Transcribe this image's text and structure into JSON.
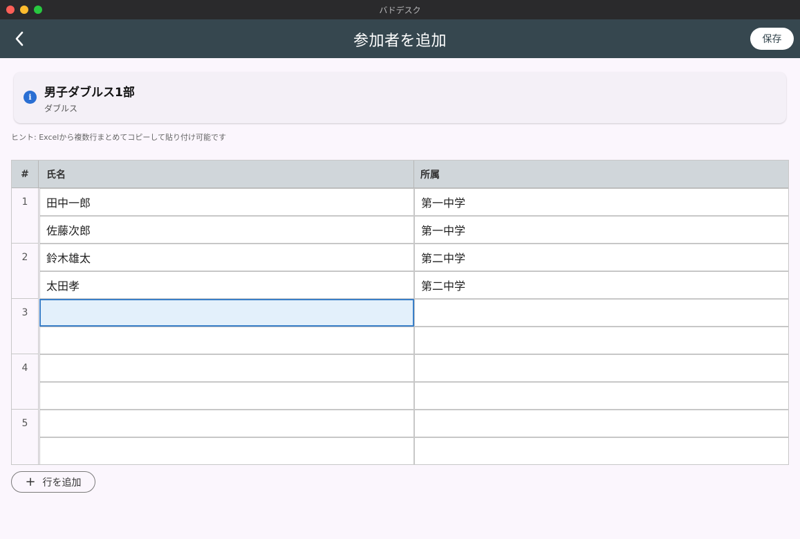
{
  "window": {
    "title": "バドデスク"
  },
  "appbar": {
    "title": "参加者を追加",
    "save_label": "保存",
    "back_icon": "chevron-left-icon"
  },
  "event": {
    "name": "男子ダブルス1部",
    "type": "ダブルス",
    "icon": "info-icon"
  },
  "hint": "ヒント: Excelから複数行まとめてコピーして貼り付け可能です",
  "table": {
    "headers": {
      "num": "#",
      "name": "氏名",
      "affiliation": "所属"
    },
    "rows": [
      {
        "num": "1",
        "players": [
          {
            "name": "田中一郎",
            "affiliation": "第一中学"
          },
          {
            "name": "佐藤次郎",
            "affiliation": "第一中学"
          }
        ]
      },
      {
        "num": "2",
        "players": [
          {
            "name": "鈴木雄太",
            "affiliation": "第二中学"
          },
          {
            "name": "太田孝",
            "affiliation": "第二中学"
          }
        ]
      },
      {
        "num": "3",
        "players": [
          {
            "name": "",
            "affiliation": ""
          },
          {
            "name": "",
            "affiliation": ""
          }
        ]
      },
      {
        "num": "4",
        "players": [
          {
            "name": "",
            "affiliation": ""
          },
          {
            "name": "",
            "affiliation": ""
          }
        ]
      },
      {
        "num": "5",
        "players": [
          {
            "name": "",
            "affiliation": ""
          },
          {
            "name": "",
            "affiliation": ""
          }
        ]
      }
    ],
    "selected_cell": {
      "row": 2,
      "player": 0,
      "column": "name"
    }
  },
  "add_row": {
    "label": "行を追加",
    "icon": "plus-icon"
  },
  "colors": {
    "appbar": "#36474f",
    "header_row": "#d0d6da",
    "info": "#2a6fd3",
    "selection": "#3a7fc8",
    "background": "#fbf6fd"
  }
}
